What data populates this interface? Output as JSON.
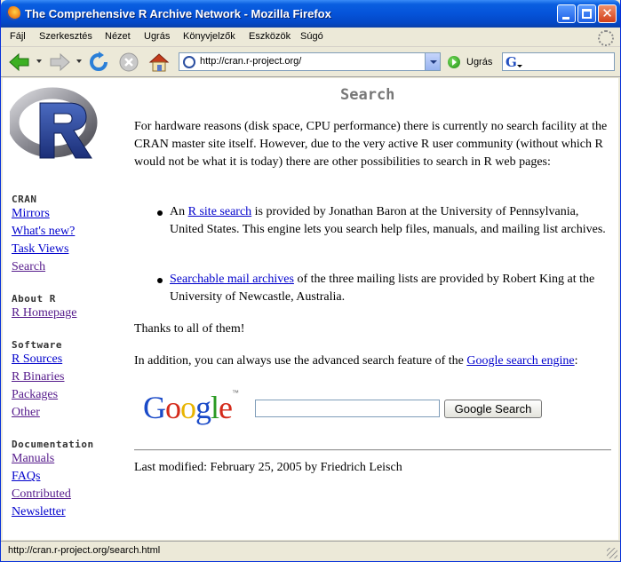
{
  "window": {
    "title": "The Comprehensive R Archive Network - Mozilla Firefox"
  },
  "menu": {
    "items": [
      "Fájl",
      "Szerkesztés",
      "Nézet",
      "Ugrás",
      "Könyvjelzők",
      "Eszközök",
      "Súgó"
    ]
  },
  "toolbar": {
    "url": "http://cran.r-project.org/",
    "go_label": "Ugrás",
    "search_value": ""
  },
  "sidebar": {
    "sections": [
      {
        "title": "CRAN",
        "links": [
          "Mirrors",
          "What's new?",
          "Task Views",
          "Search"
        ]
      },
      {
        "title": "About R",
        "links": [
          "R Homepage"
        ]
      },
      {
        "title": "Software",
        "links": [
          "R Sources",
          "R Binaries",
          "Packages",
          "Other"
        ]
      },
      {
        "title": "Documentation",
        "links": [
          "Manuals",
          "FAQs",
          "Contributed",
          "Newsletter"
        ]
      }
    ]
  },
  "main": {
    "title": "Search",
    "intro": "For hardware reasons (disk space, CPU performance) there is currently no search facility at the CRAN master site itself. However, due to the very active R user community (without which R would not be what it is today) there are other possibilities to search in R web pages:",
    "bullets": [
      {
        "pre": "An ",
        "link": "R site search",
        "post": " is provided by Jonathan Baron at the University of Pennsylvania, United States. This engine lets you search help files, manuals, and mailing list archives."
      },
      {
        "pre": "",
        "link": "Searchable mail archives",
        "post": " of the three mailing lists are provided by Robert King at the University of Newcastle, Australia."
      }
    ],
    "thanks": "Thanks to all of them!",
    "addition_pre": "In addition, you can always use the advanced search feature of the ",
    "addition_link": "Google search engine",
    "addition_post": ":",
    "google_logo": "Google",
    "google_tm": "™",
    "google_input_value": "",
    "google_button": "Google Search",
    "last_modified": "Last modified: February 25, 2005 by Friedrich Leisch"
  },
  "status": {
    "text": "http://cran.r-project.org/search.html"
  }
}
